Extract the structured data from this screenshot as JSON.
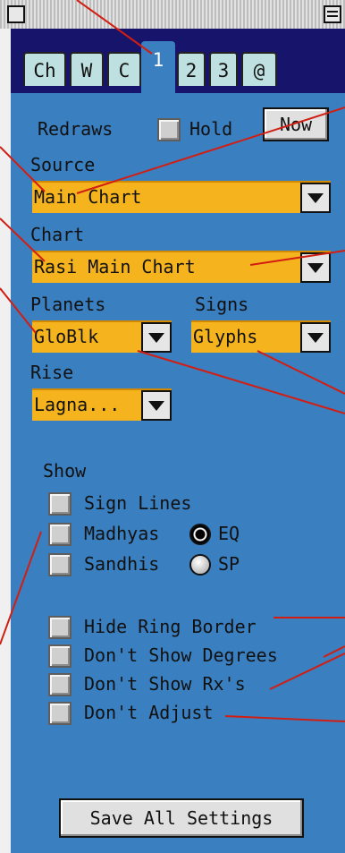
{
  "tabs": [
    {
      "label": "Ch",
      "active": false
    },
    {
      "label": "W",
      "active": false
    },
    {
      "label": "C",
      "active": false
    },
    {
      "label": "1",
      "active": true
    },
    {
      "label": "2",
      "active": false
    },
    {
      "label": "3",
      "active": false
    },
    {
      "label": "@",
      "active": false
    }
  ],
  "redraws": {
    "label": "Redraws",
    "hold_label": "Hold",
    "hold_checked": false,
    "now_label": "Now"
  },
  "source": {
    "label": "Source",
    "value": "Main Chart"
  },
  "chart": {
    "label": "Chart",
    "value": "Rasi Main Chart"
  },
  "planets": {
    "label": "Planets",
    "value": "GloBlk"
  },
  "signs": {
    "label": "Signs",
    "value": "Glyphs"
  },
  "rise": {
    "label": "Rise",
    "value": "Lagna..."
  },
  "show": {
    "label": "Show",
    "sign_lines": {
      "label": "Sign Lines",
      "checked": false
    },
    "madhyas": {
      "label": "Madhyas",
      "checked": false
    },
    "sandhis": {
      "label": "Sandhis",
      "checked": false
    },
    "eq_label": "EQ",
    "sp_label": "SP",
    "selected_mode": "EQ"
  },
  "options": [
    {
      "label": "Hide Ring Border",
      "checked": false
    },
    {
      "label": "Don't Show Degrees",
      "checked": false
    },
    {
      "label": "Don't Show Rx's",
      "checked": false
    },
    {
      "label": "Don't Adjust",
      "checked": false
    }
  ],
  "save_button_label": "Save All Settings",
  "colors": {
    "panel": "#3a7fc0",
    "popup": "#f5b41e",
    "tab_strip": "#17156b",
    "tab": "#bfe0e0",
    "annotation": "#d21e12"
  }
}
